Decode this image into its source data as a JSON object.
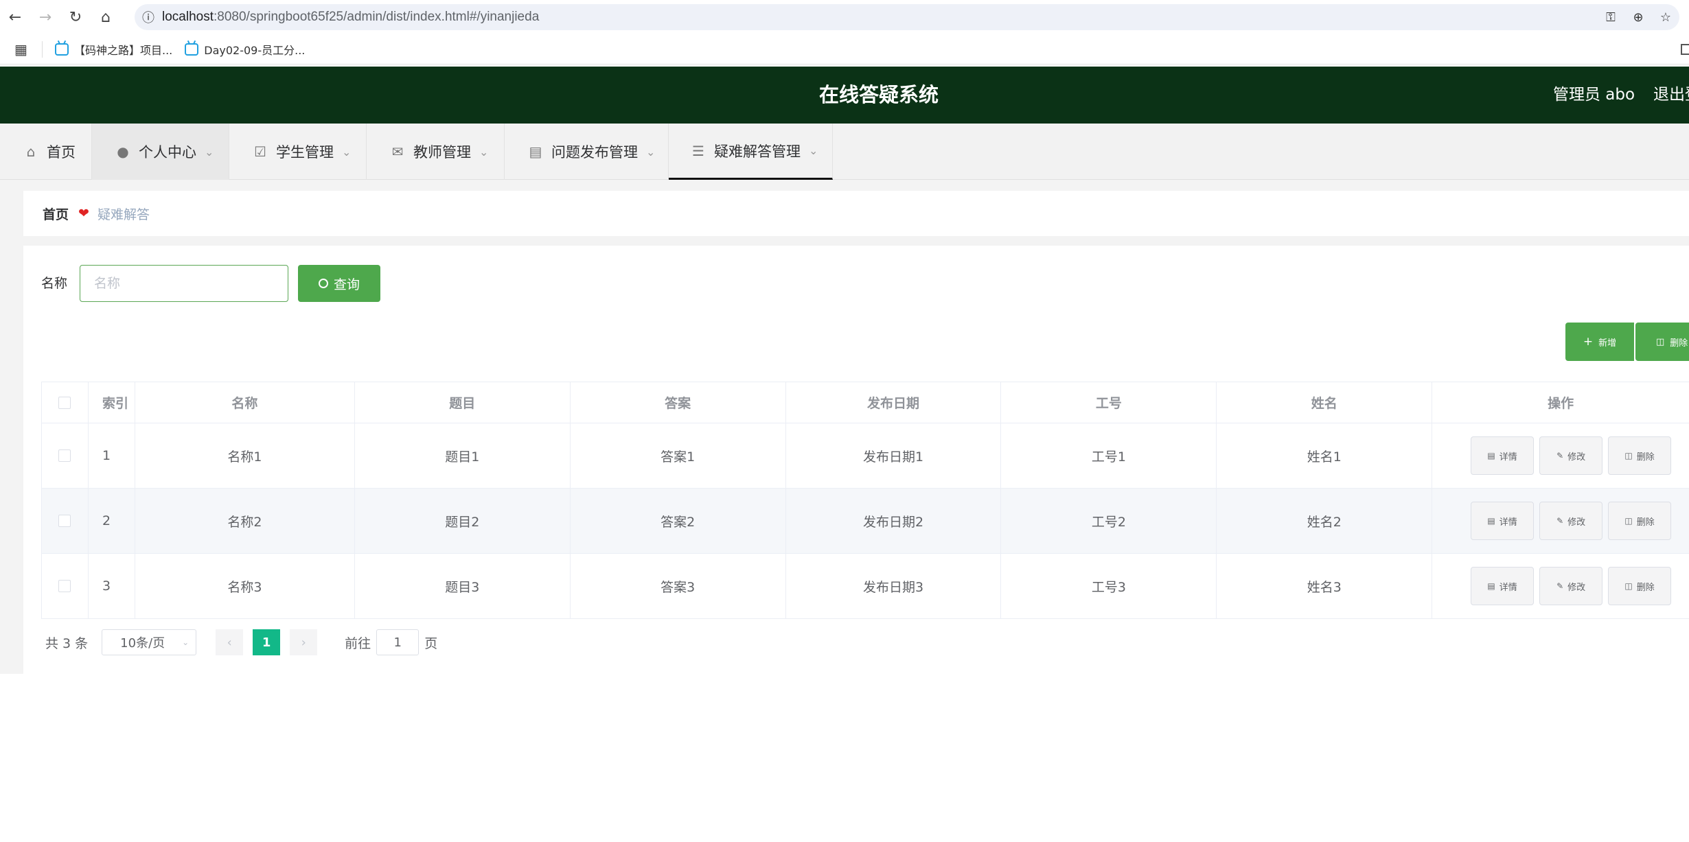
{
  "browser": {
    "url_host": "localhost",
    "url_rest": ":8080/springboot65f25/admin/dist/index.html#/yinanjieda",
    "bookmarks": [
      "【码神之路】项目...",
      "Day02-09-员工分..."
    ]
  },
  "header": {
    "title": "在线答疑系统",
    "user": "管理员 abo",
    "logout": "退出登录"
  },
  "menu": [
    {
      "label": "首页",
      "icon": "home-icon"
    },
    {
      "label": "个人中心",
      "icon": "user-icon"
    },
    {
      "label": "学生管理",
      "icon": "clipboard-icon"
    },
    {
      "label": "教师管理",
      "icon": "mail-icon"
    },
    {
      "label": "问题发布管理",
      "icon": "briefcase-icon"
    },
    {
      "label": "疑难解答管理",
      "icon": "chat-icon"
    }
  ],
  "breadcrumb": {
    "home": "首页",
    "current": "疑难解答"
  },
  "search": {
    "label": "名称",
    "placeholder": "名称",
    "button": "查询"
  },
  "actions": {
    "add": "新增",
    "delete": "删除"
  },
  "table": {
    "columns": [
      "索引",
      "名称",
      "题目",
      "答案",
      "发布日期",
      "工号",
      "姓名",
      "操作"
    ],
    "rows": [
      {
        "idx": "1",
        "name": "名称1",
        "q": "题目1",
        "a": "答案1",
        "date": "发布日期1",
        "no": "工号1",
        "xm": "姓名1"
      },
      {
        "idx": "2",
        "name": "名称2",
        "q": "题目2",
        "a": "答案2",
        "date": "发布日期2",
        "no": "工号2",
        "xm": "姓名2"
      },
      {
        "idx": "3",
        "name": "名称3",
        "q": "题目3",
        "a": "答案3",
        "date": "发布日期3",
        "no": "工号3",
        "xm": "姓名3"
      }
    ],
    "row_actions": {
      "detail": "详情",
      "edit": "修改",
      "delete": "删除"
    }
  },
  "pagination": {
    "total": "共 3 条",
    "page_size": "10条/页",
    "current": "1",
    "goto_prefix": "前往",
    "goto_value": "1",
    "goto_suffix": "页"
  },
  "colors": {
    "header_bg": "#0b3216",
    "primary": "#4ea84c",
    "pager_active": "#12b888"
  }
}
